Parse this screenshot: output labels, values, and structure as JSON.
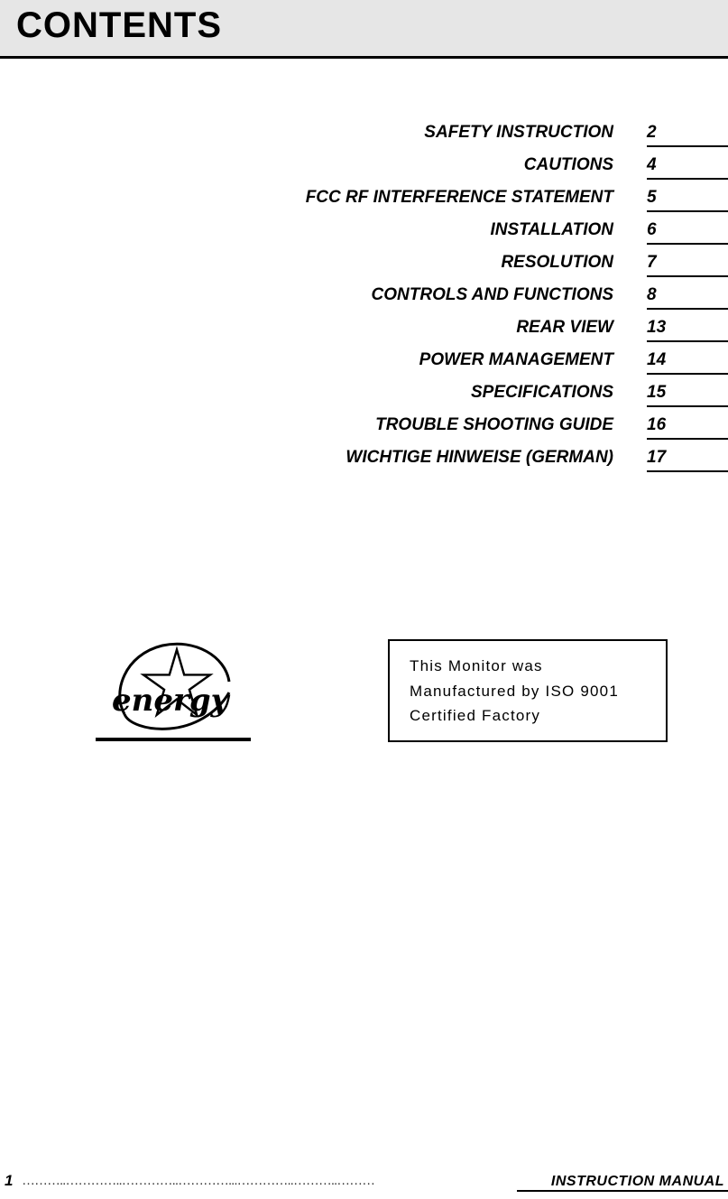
{
  "header": {
    "title": "CONTENTS"
  },
  "contents": {
    "items": [
      {
        "title": "SAFETY INSTRUCTION",
        "page": "2"
      },
      {
        "title": "CAUTIONS",
        "page": "4"
      },
      {
        "title": "FCC RF INTERFERENCE STATEMENT",
        "page": "5"
      },
      {
        "title": "INSTALLATION",
        "page": "6"
      },
      {
        "title": "RESOLUTION",
        "page": "7"
      },
      {
        "title": "CONTROLS AND FUNCTIONS",
        "page": "8"
      },
      {
        "title": "REAR VIEW",
        "page": "13"
      },
      {
        "title": "POWER MANAGEMENT",
        "page": "14"
      },
      {
        "title": "SPECIFICATIONS",
        "page": "15"
      },
      {
        "title": "TROUBLE SHOOTING GUIDE",
        "page": "16"
      },
      {
        "title": "WICHTIGE HINWEISE (GERMAN)",
        "page": "17"
      }
    ]
  },
  "logo": {
    "name": "energy-star-logo",
    "wordmark": "energy"
  },
  "iso_box": {
    "line1": "This Monitor was",
    "line2": "Manufactured by ISO 9001",
    "line3": "Certified Factory"
  },
  "footer": {
    "page_number": "1",
    "dots": "………..…………..…………..…………...…………..………..………",
    "label": "INSTRUCTION  MANUAL"
  }
}
